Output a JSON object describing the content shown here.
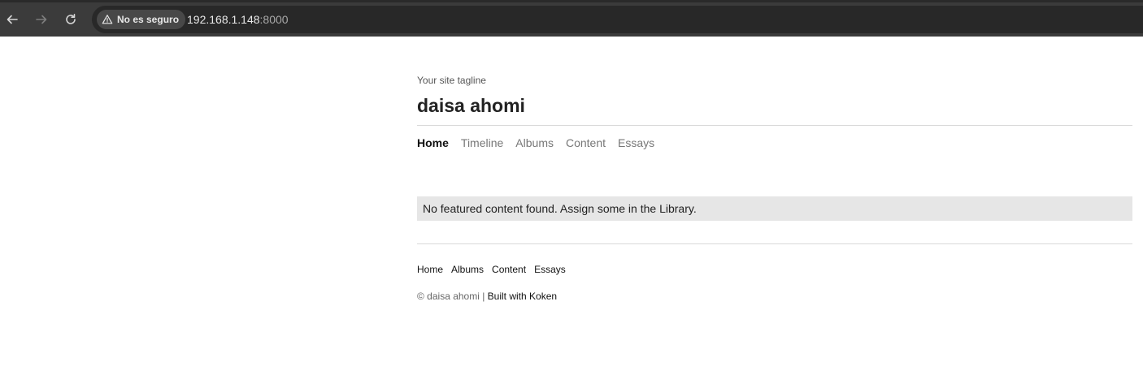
{
  "browser": {
    "security_label": "No es seguro",
    "url_host": "192.168.1.148",
    "url_port": ":8000",
    "icons": {
      "back": "arrow-left-icon",
      "forward": "arrow-right-icon",
      "reload": "reload-icon",
      "security": "warning-triangle-icon"
    },
    "colors": {
      "toolbar": "#3b3b3b",
      "omnibox": "#282828"
    }
  },
  "site": {
    "tagline": "Your site tagline",
    "title": "daisa ahomi"
  },
  "main_nav": {
    "items": [
      {
        "label": "Home",
        "active": true
      },
      {
        "label": "Timeline",
        "active": false
      },
      {
        "label": "Albums",
        "active": false
      },
      {
        "label": "Content",
        "active": false
      },
      {
        "label": "Essays",
        "active": false
      }
    ]
  },
  "notice": {
    "text": "No featured content found. Assign some in the Library."
  },
  "footer": {
    "nav": [
      {
        "label": "Home"
      },
      {
        "label": "Albums"
      },
      {
        "label": "Content"
      },
      {
        "label": "Essays"
      }
    ],
    "copyright_text": "© daisa ahomi | ",
    "built_with_label": "Built with Koken"
  }
}
